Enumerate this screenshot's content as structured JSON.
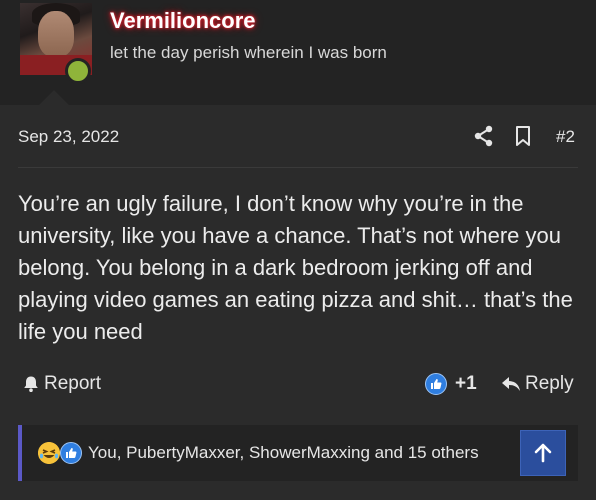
{
  "user": {
    "name": "Vermilioncore",
    "title": "let the day perish wherein I was born"
  },
  "post": {
    "date": "Sep 23, 2022",
    "number": "#2",
    "body": "You’re an ugly failure, I don’t know why you’re in the university, like you have a chance. That’s not where you belong. You belong in a dark bedroom jerking off and playing video games an eating pizza and shit… that’s the life you need"
  },
  "actions": {
    "report_label": "Report",
    "like_count": "+1",
    "reply_label": "Reply"
  },
  "reactions": {
    "summary": "You, PubertyMaxxer, ShowerMaxxing and 15 others",
    "icons": [
      "haha-reaction-icon",
      "like-reaction-icon"
    ]
  },
  "colors": {
    "username_glow": "#d0202a",
    "online": "#8fb43a",
    "accent": "#5b59c7",
    "scroll_button": "#2b4e9d",
    "like": "#2f7ee0"
  }
}
